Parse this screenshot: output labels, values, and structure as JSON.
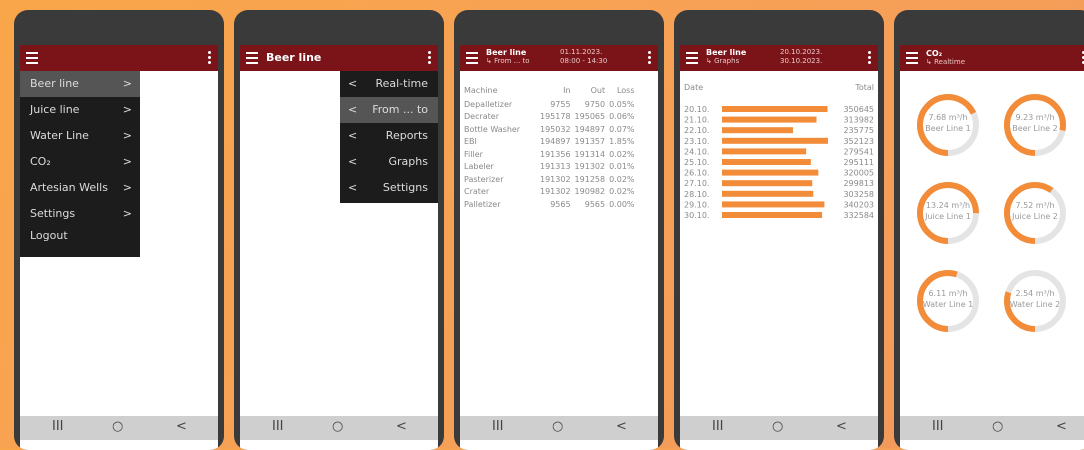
{
  "colors": {
    "appbar": "#7a1418",
    "accent": "#f28c38",
    "menu_bg": "#1c1c1c",
    "menu_selected": "#555555"
  },
  "icons": {
    "menu": "hamburger-icon",
    "more": "kebab-icon",
    "chevron_right": "chevron-right-icon",
    "chevron_left": "chevron-left-icon",
    "subdir": "subdirectory-arrow-icon",
    "nav_recent": "recent-apps-icon",
    "nav_home": "home-icon",
    "nav_back": "back-icon"
  },
  "navbar": {
    "recent": "III",
    "home": "○",
    "back": "<"
  },
  "screen1": {
    "menu": [
      {
        "label": "Beer line",
        "chevron": ">",
        "selected": true
      },
      {
        "label": "Juice line",
        "chevron": ">"
      },
      {
        "label": "Water Line",
        "chevron": ">"
      },
      {
        "label": "CO₂",
        "chevron": ">"
      },
      {
        "label": "Artesian Wells",
        "chevron": ">"
      },
      {
        "label": "Settings",
        "chevron": ">"
      },
      {
        "label": "Logout",
        "chevron": ""
      }
    ]
  },
  "screen2": {
    "title": "Beer line",
    "submenu": [
      {
        "label": "Real-time",
        "chevron": "<"
      },
      {
        "label": "From ... to",
        "chevron": "<",
        "selected": true
      },
      {
        "label": "Reports",
        "chevron": "<"
      },
      {
        "label": "Graphs",
        "chevron": "<"
      },
      {
        "label": "Settigns",
        "chevron": "<"
      }
    ]
  },
  "screen3": {
    "title": "Beer line",
    "subtitle": "From ... to",
    "date": "01.11.2023.",
    "time": "08:00 - 14:30",
    "headers": [
      "Machine",
      "In",
      "Out",
      "Loss"
    ],
    "rows": [
      [
        "Depalletizer",
        "9755",
        "9750",
        "0.05%"
      ],
      [
        "Decrater",
        "195178",
        "195065",
        "0.06%"
      ],
      [
        "Bottle Washer",
        "195032",
        "194897",
        "0.07%"
      ],
      [
        "EBI",
        "194897",
        "191357",
        "1.85%"
      ],
      [
        "Filler",
        "191356",
        "191314",
        "0.02%"
      ],
      [
        "Labeler",
        "191313",
        "191302",
        "0.01%"
      ],
      [
        "Pasterizer",
        "191302",
        "191258",
        "0.02%"
      ],
      [
        "Crater",
        "191302",
        "190982",
        "0.02%"
      ],
      [
        "Palletizer",
        "9565",
        "9565",
        "0.00%"
      ]
    ]
  },
  "screen4": {
    "title": "Beer line",
    "subtitle": "Graphs",
    "date_from": "20.10.2023.",
    "date_to": "30.10.2023.",
    "col_date": "Date",
    "col_total": "Total"
  },
  "chart_data": {
    "type": "bar",
    "orientation": "horizontal",
    "categories": [
      "20.10.",
      "21.10.",
      "22.10.",
      "23.10.",
      "24.10.",
      "25.10.",
      "26.10.",
      "27.10.",
      "28.10.",
      "29.10.",
      "30.10."
    ],
    "values": [
      350645,
      313982,
      235775,
      352123,
      279541,
      295111,
      320005,
      299813,
      303258,
      340203,
      332584
    ],
    "xlabel": "Total",
    "ylabel": "Date"
  },
  "screen5": {
    "title": "CO₂",
    "subtitle": "Realtime",
    "gauges": [
      {
        "value": "7.68 m³/h",
        "label": "Beer Line 1",
        "fill": 0.68
      },
      {
        "value": "9.23 m³/h",
        "label": "Beer Line 2",
        "fill": 0.78
      },
      {
        "value": "13.24 m³/h",
        "label": "Juice Line 1",
        "fill": 0.75
      },
      {
        "value": "7.52 m³/h",
        "label": "Juice Line 2",
        "fill": 0.6
      },
      {
        "value": "6.11 m³/h",
        "label": "Water Line 1",
        "fill": 0.55
      },
      {
        "value": "2.54 m³/h",
        "label": "Water Line 2",
        "fill": 0.3
      }
    ]
  }
}
